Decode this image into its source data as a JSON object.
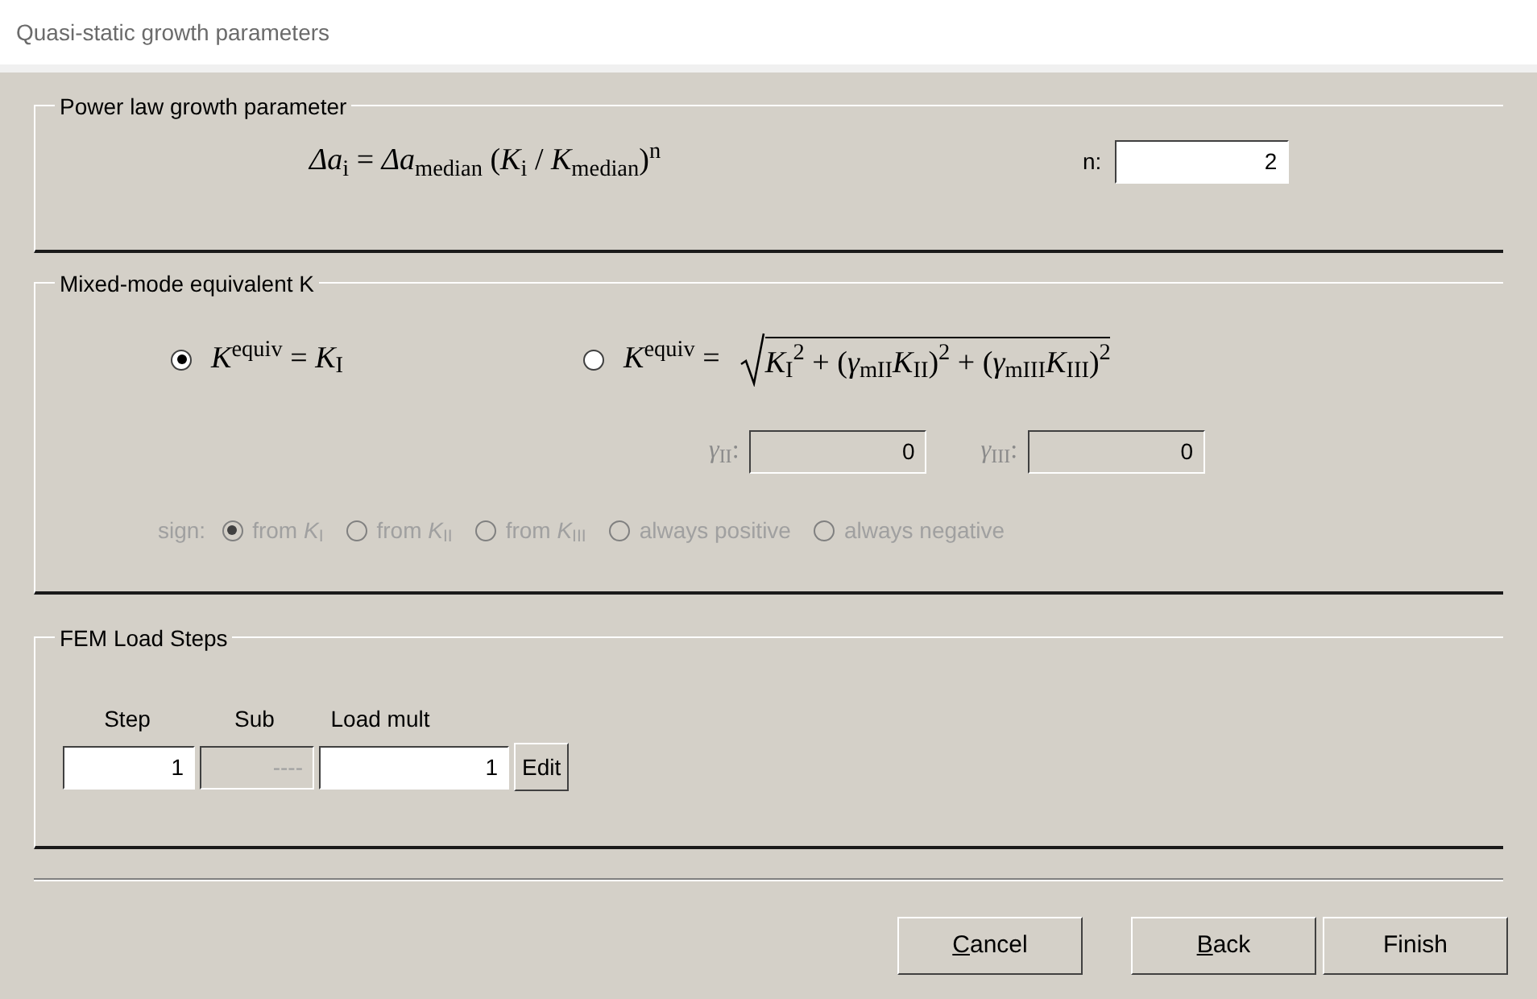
{
  "window": {
    "title": "Quasi-static growth parameters"
  },
  "power_law": {
    "title": "Power law growth parameter",
    "formula": "*Δa*$_{i}$ = *Δa*$_{median}$ (*K*$_{i}$ / *K*$_{median}$)$^{n}$",
    "n_label": "n:",
    "n_value": "2"
  },
  "mixed_mode": {
    "title": "Mixed-mode equivalent K",
    "options": [
      {
        "lhs": "*K*$^{equiv}$ = *K*$_{I}$",
        "selected": true
      },
      {
        "lhs": "*K*$^{equiv}$ =",
        "radicand": "*K*$_{I}$$^{2}$ + (*γ*$_{mII}$*K*$_{II}$)$^{2}$ + (*γ*$_{mIII}$*K*$_{III}$)$^{2}$",
        "selected": false
      }
    ],
    "gammas": [
      {
        "label": "*γ*$_{II}$:",
        "value": "0",
        "disabled": true
      },
      {
        "label": "*γ*$_{III}$:",
        "value": "0",
        "disabled": true
      }
    ],
    "sign_label": "sign:",
    "sign_options": [
      {
        "label": "from *K*$_{I}$",
        "selected": true,
        "disabled": true
      },
      {
        "label": "from *K*$_{II}$",
        "selected": false,
        "disabled": true
      },
      {
        "label": "from *K*$_{III}$",
        "selected": false,
        "disabled": true
      },
      {
        "label": "always positive",
        "selected": false,
        "disabled": true
      },
      {
        "label": "always negative",
        "selected": false,
        "disabled": true
      }
    ]
  },
  "load_steps": {
    "title": "FEM Load Steps",
    "columns": [
      "Step",
      "Sub",
      "Load mult"
    ],
    "step": "1",
    "sub": "----",
    "sub_disabled": true,
    "load_mult": "1",
    "edit_button": "Edit"
  },
  "buttons": [
    {
      "label": "Cancel",
      "first_letter_underlined": true
    },
    {
      "label": "Back",
      "first_letter_underlined": true
    },
    {
      "label": "Finish",
      "first_letter_underlined": false
    }
  ]
}
